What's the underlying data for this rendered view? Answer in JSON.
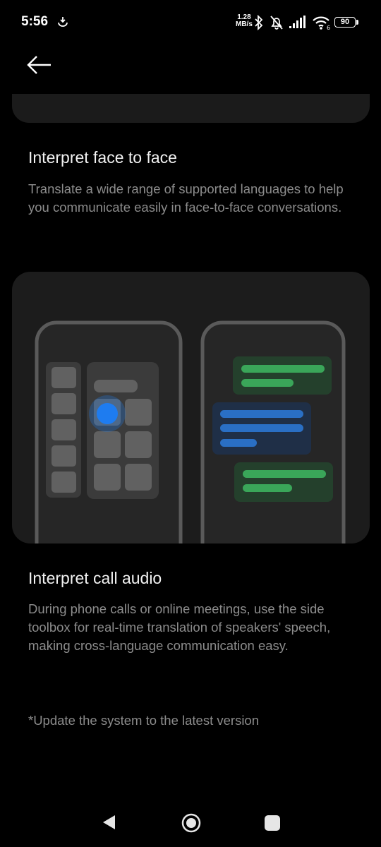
{
  "status_bar": {
    "time": "5:56",
    "speed_value": "1.28",
    "speed_unit": "MB/s",
    "battery": "90",
    "signal_sub": "6"
  },
  "icons": [
    "download-icon",
    "bluetooth-icon",
    "mute-icon",
    "signal-icon",
    "wifi-icon",
    "back-arrow-icon",
    "nav-back-icon",
    "nav-home-icon",
    "nav-recent-icon"
  ],
  "sections": [
    {
      "title": "Interpret face to face",
      "description": "Translate a wide range of supported languages to help you communicate easily in face-to-face conversations."
    },
    {
      "title": "Interpret call audio",
      "description": "During phone calls or online meetings, use the side toolbox for real-time translation of speakers' speech, making cross-language communication easy."
    }
  ],
  "footnote": "*Update the system to the latest version",
  "colors": {
    "background": "#000000",
    "card": "#1c1c1c",
    "accent_blue": "#1e7cf0",
    "bubble_green": "#3aa659",
    "bubble_blue": "#2a6fc4"
  }
}
